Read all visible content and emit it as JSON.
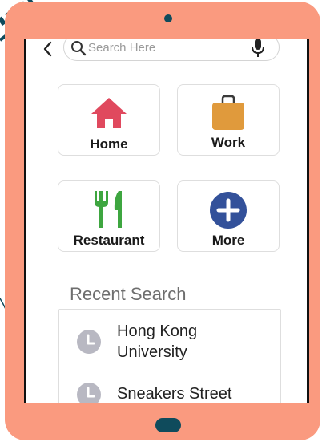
{
  "search": {
    "placeholder": "Search Here",
    "back_icon": "chevron-left-icon",
    "search_icon": "search-icon",
    "mic_icon": "microphone-icon"
  },
  "tiles": [
    {
      "label": "Home",
      "icon": "home-icon",
      "color": "#e0495e"
    },
    {
      "label": "Work",
      "icon": "briefcase-icon",
      "color": "#e09a3c"
    },
    {
      "label": "Restaurant",
      "icon": "fork-knife-icon",
      "color": "#3ea640"
    },
    {
      "label": "More",
      "icon": "plus-circle-icon",
      "color": "#33519a"
    }
  ],
  "recent": {
    "title": "Recent Search",
    "items": [
      {
        "line1": "Hong Kong",
        "line2": "University",
        "icon": "clock-icon"
      },
      {
        "line1": "Sneakers Street",
        "line2": "",
        "icon": "clock-icon"
      }
    ]
  },
  "colors": {
    "frame": "#fa9a7f",
    "accent_dark": "#0f4b5c",
    "clock_gray": "#b8b8c2"
  }
}
